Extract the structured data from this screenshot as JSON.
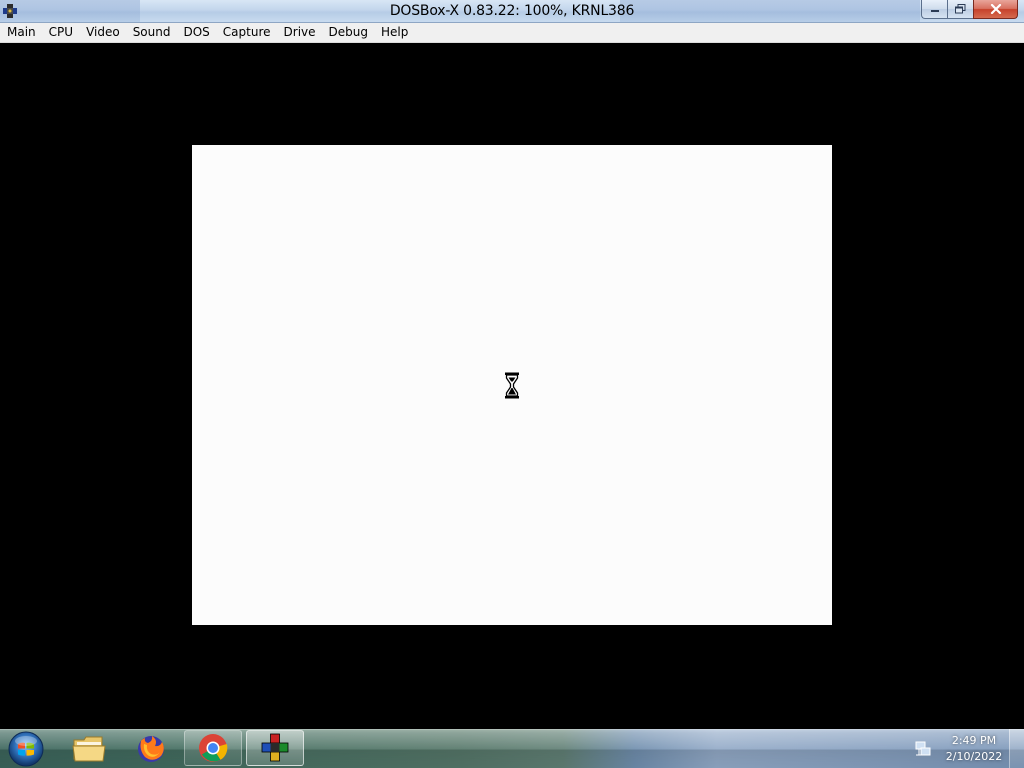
{
  "window": {
    "title": "DOSBox-X 0.83.22: 100%, KRNL386",
    "app_icon": "dosbox-x-icon",
    "caption_buttons": [
      "minimize-icon",
      "restore-icon",
      "close-icon"
    ]
  },
  "menubar": {
    "items": [
      {
        "label": "Main"
      },
      {
        "label": "CPU"
      },
      {
        "label": "Video"
      },
      {
        "label": "Sound"
      },
      {
        "label": "DOS"
      },
      {
        "label": "Capture"
      },
      {
        "label": "Drive"
      },
      {
        "label": "Debug"
      },
      {
        "label": "Help"
      }
    ]
  },
  "emulator": {
    "screen_color": "#fcfcfc",
    "cursor": "hourglass-icon"
  },
  "taskbar": {
    "start_icon": "windows-start-icon",
    "pinned": [
      {
        "icon": "file-explorer-icon",
        "state": "pinned"
      },
      {
        "icon": "firefox-icon",
        "state": "pinned"
      },
      {
        "icon": "chrome-icon",
        "state": "open"
      },
      {
        "icon": "dosbox-icon",
        "state": "active"
      }
    ],
    "tray": {
      "network_icon": "network-icon",
      "time": "2:49 PM",
      "date": "2/10/2022"
    }
  },
  "colors": {
    "title_bar": "#c3d6ec",
    "menu_bar": "#f0f0f0",
    "emulator_background": "#000000",
    "close_button": "#c6412b",
    "taskbar": "#4b6f9d"
  }
}
